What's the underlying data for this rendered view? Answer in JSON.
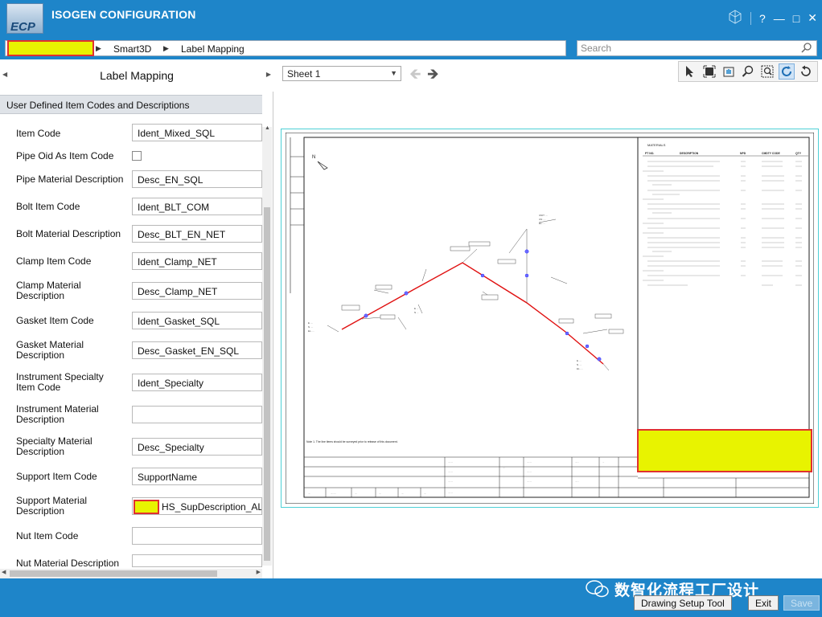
{
  "app": {
    "title": "ISOGEN CONFIGURATION",
    "logo_text": "ECP"
  },
  "window_controls": {
    "help": "?",
    "minimize": "—",
    "maximize": "□",
    "close": "✕"
  },
  "breadcrumb": {
    "items": [
      "",
      "Smart3D",
      "Label Mapping"
    ]
  },
  "search": {
    "placeholder": "Search"
  },
  "left_panel": {
    "title": "Label Mapping",
    "section": "User Defined Item Codes and Descriptions",
    "fields": [
      {
        "label": "Item Code",
        "value": "Ident_Mixed_SQL",
        "type": "text"
      },
      {
        "label": "Pipe Oid As Item Code",
        "value": "",
        "type": "checkbox"
      },
      {
        "label": "Pipe Material Description",
        "value": "Desc_EN_SQL",
        "type": "text"
      },
      {
        "label": "Bolt Item Code",
        "value": "Ident_BLT_COM",
        "type": "text"
      },
      {
        "label": "Bolt Material Description",
        "value": "Desc_BLT_EN_NET",
        "type": "text"
      },
      {
        "label": "Clamp Item Code",
        "value": "Ident_Clamp_NET",
        "type": "text"
      },
      {
        "label": "Clamp Material Description",
        "value": "Desc_Clamp_NET",
        "type": "text"
      },
      {
        "label": "Gasket Item Code",
        "value": "Ident_Gasket_SQL",
        "type": "text"
      },
      {
        "label": "Gasket Material Description",
        "value": "Desc_Gasket_EN_SQL",
        "type": "text"
      },
      {
        "label": "Instrument Specialty Item Code",
        "value": "Ident_Specialty",
        "type": "text"
      },
      {
        "label": "Instrument Material Description",
        "value": "",
        "type": "text"
      },
      {
        "label": "Specialty Material Description",
        "value": "Desc_Specialty",
        "type": "text"
      },
      {
        "label": "Support Item Code",
        "value": "SupportName",
        "type": "text"
      },
      {
        "label": "Support Material Description",
        "value": "HS_SupDescription_ALL",
        "type": "text"
      },
      {
        "label": "Nut Item Code",
        "value": "",
        "type": "text"
      },
      {
        "label": "Nut Material Description",
        "value": "",
        "type": "text"
      }
    ]
  },
  "viewer": {
    "sheet": "Sheet 1",
    "tools": [
      "select-arrow-icon",
      "zoom-extents-icon",
      "pan-icon",
      "zoom-icon",
      "zoom-window-icon",
      "refresh-icon",
      "rotate-icon"
    ],
    "north_label": "N",
    "note_text": "Note 1. The line items should be surveyed prior to release of this document.",
    "bom_title": "MATERIALS",
    "bom_headers": [
      "PT NO.",
      "DESCRIPTION",
      "NPD",
      "CMDTY CODE",
      "QTY"
    ]
  },
  "footer": {
    "watermark": "数智化流程工厂设计",
    "buttons": {
      "drawing_setup": "Drawing Setup Tool",
      "exit": "Exit",
      "save": "Save"
    }
  },
  "colors": {
    "accent": "#1e85c9",
    "highlight": "#e8f300",
    "highlight_border": "#e0312f",
    "pipe": "#e01010"
  }
}
